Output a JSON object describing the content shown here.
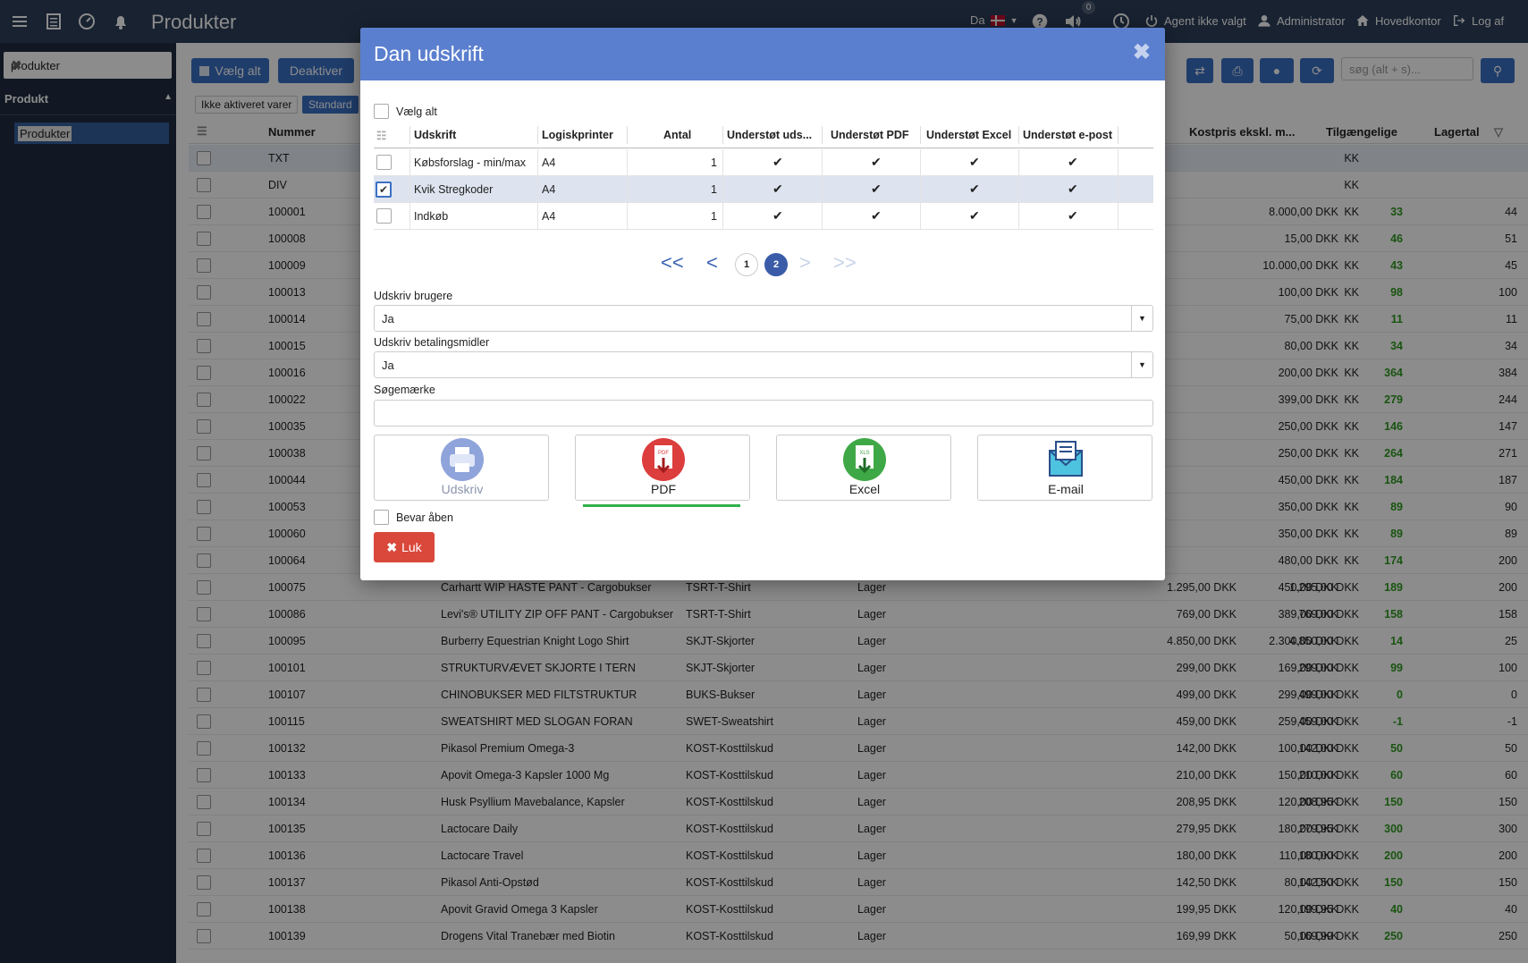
{
  "topbar": {
    "title": "Produkter",
    "lang": "Da",
    "notif_count": "0",
    "agent": "Agent ikke valgt",
    "user": "Administrator",
    "office": "Hovedkontor",
    "logout": "Log af"
  },
  "sidebar": {
    "search_value": "produkter",
    "section": "Produkt",
    "item": "Produkter"
  },
  "toolbar": {
    "select_all": "Vælg alt",
    "deactivate": "Deaktiver",
    "filter_inactive": "Ikke aktiveret varer",
    "filter_standard": "Standard",
    "search_placeholder": "søg (alt + s)..."
  },
  "table": {
    "headers": [
      "Nummer",
      "Kostpris ekskl. m...",
      "Tilgængelige",
      "Lagertal"
    ],
    "rows": [
      {
        "num": "TXT",
        "name": "",
        "group": "",
        "type": "",
        "p1": "",
        "p2": "KK",
        "cost": "",
        "avail": "",
        "stock": ""
      },
      {
        "num": "DIV",
        "name": "",
        "group": "",
        "type": "",
        "p1": "",
        "p2": "KK",
        "cost": "",
        "avail": "",
        "stock": ""
      },
      {
        "num": "100001",
        "name": "",
        "group": "",
        "type": "",
        "p1": "",
        "p2": "KK",
        "cost": "8.000,00 DKK",
        "avail": "33",
        "stock": "44"
      },
      {
        "num": "100008",
        "name": "",
        "group": "",
        "type": "",
        "p1": "",
        "p2": "KK",
        "cost": "15,00 DKK",
        "avail": "46",
        "stock": "51"
      },
      {
        "num": "100009",
        "name": "",
        "group": "",
        "type": "",
        "p1": "",
        "p2": "KK",
        "cost": "10.000,00 DKK",
        "avail": "43",
        "stock": "45"
      },
      {
        "num": "100013",
        "name": "",
        "group": "",
        "type": "",
        "p1": "",
        "p2": "KK",
        "cost": "100,00 DKK",
        "avail": "98",
        "stock": "100"
      },
      {
        "num": "100014",
        "name": "",
        "group": "",
        "type": "",
        "p1": "",
        "p2": "KK",
        "cost": "75,00 DKK",
        "avail": "11",
        "stock": "11"
      },
      {
        "num": "100015",
        "name": "",
        "group": "",
        "type": "",
        "p1": "",
        "p2": "KK",
        "cost": "80,00 DKK",
        "avail": "34",
        "stock": "34"
      },
      {
        "num": "100016",
        "name": "",
        "group": "",
        "type": "",
        "p1": "",
        "p2": "KK",
        "cost": "200,00 DKK",
        "avail": "364",
        "stock": "384"
      },
      {
        "num": "100022",
        "name": "",
        "group": "",
        "type": "",
        "p1": "",
        "p2": "KK",
        "cost": "399,00 DKK",
        "avail": "279",
        "stock": "244"
      },
      {
        "num": "100035",
        "name": "",
        "group": "",
        "type": "",
        "p1": "",
        "p2": "KK",
        "cost": "250,00 DKK",
        "avail": "146",
        "stock": "147"
      },
      {
        "num": "100038",
        "name": "",
        "group": "",
        "type": "",
        "p1": "",
        "p2": "KK",
        "cost": "250,00 DKK",
        "avail": "264",
        "stock": "271"
      },
      {
        "num": "100044",
        "name": "",
        "group": "",
        "type": "",
        "p1": "",
        "p2": "KK",
        "cost": "450,00 DKK",
        "avail": "184",
        "stock": "187"
      },
      {
        "num": "100053",
        "name": "",
        "group": "",
        "type": "",
        "p1": "",
        "p2": "KK",
        "cost": "350,00 DKK",
        "avail": "89",
        "stock": "90"
      },
      {
        "num": "100060",
        "name": "",
        "group": "",
        "type": "",
        "p1": "",
        "p2": "KK",
        "cost": "350,00 DKK",
        "avail": "89",
        "stock": "89"
      },
      {
        "num": "100064",
        "name": "",
        "group": "",
        "type": "",
        "p1": "",
        "p2": "KK",
        "cost": "480,00 DKK",
        "avail": "174",
        "stock": "200"
      },
      {
        "num": "100075",
        "name": "Carhartt WIP HASTE PANT - Cargobukser",
        "group": "TSRT-T-Shirt",
        "type": "Lager",
        "p1": "1.295,00 DKK",
        "p2": "1.295,00 DKK",
        "cost": "450,00 DKK",
        "avail": "189",
        "stock": "200"
      },
      {
        "num": "100086",
        "name": "Levi's® UTILITY ZIP OFF PANT - Cargobukser",
        "group": "TSRT-T-Shirt",
        "type": "Lager",
        "p1": "769,00 DKK",
        "p2": "769,00 DKK",
        "cost": "389,00 DKK",
        "avail": "158",
        "stock": "158"
      },
      {
        "num": "100095",
        "name": "Burberry Equestrian Knight Logo Shirt",
        "group": "SKJT-Skjorter",
        "type": "Lager",
        "p1": "4.850,00 DKK",
        "p2": "4.850,00 DKK",
        "cost": "2.300,00 DKK",
        "avail": "14",
        "stock": "25"
      },
      {
        "num": "100101",
        "name": "STRUKTURVÆVET SKJORTE I TERN",
        "group": "SKJT-Skjorter",
        "type": "Lager",
        "p1": "299,00 DKK",
        "p2": "299,00 DKK",
        "cost": "169,00 DKK",
        "avail": "99",
        "stock": "100"
      },
      {
        "num": "100107",
        "name": "CHINOBUKSER MED FILTSTRUKTUR",
        "group": "BUKS-Bukser",
        "type": "Lager",
        "p1": "499,00 DKK",
        "p2": "499,00 DKK",
        "cost": "299,00 DKK",
        "avail": "0",
        "stock": "0"
      },
      {
        "num": "100115",
        "name": "SWEATSHIRT MED SLOGAN FORAN",
        "group": "SWET-Sweatshirt",
        "type": "Lager",
        "p1": "459,00 DKK",
        "p2": "459,00 DKK",
        "cost": "259,00 DKK",
        "avail": "-1",
        "stock": "-1"
      },
      {
        "num": "100132",
        "name": "Pikasol Premium Omega-3",
        "group": "KOST-Kosttilskud",
        "type": "Lager",
        "p1": "142,00 DKK",
        "p2": "142,00 DKK",
        "cost": "100,00 DKK",
        "avail": "50",
        "stock": "50"
      },
      {
        "num": "100133",
        "name": "Apovit Omega-3 Kapsler 1000 Mg",
        "group": "KOST-Kosttilskud",
        "type": "Lager",
        "p1": "210,00 DKK",
        "p2": "210,00 DKK",
        "cost": "150,00 DKK",
        "avail": "60",
        "stock": "60"
      },
      {
        "num": "100134",
        "name": "Husk Psyllium Mavebalance, Kapsler",
        "group": "KOST-Kosttilskud",
        "type": "Lager",
        "p1": "208,95 DKK",
        "p2": "208,95 DKK",
        "cost": "120,00 DKK",
        "avail": "150",
        "stock": "150"
      },
      {
        "num": "100135",
        "name": "Lactocare Daily",
        "group": "KOST-Kosttilskud",
        "type": "Lager",
        "p1": "279,95 DKK",
        "p2": "279,95 DKK",
        "cost": "180,00 DKK",
        "avail": "300",
        "stock": "300"
      },
      {
        "num": "100136",
        "name": "Lactocare Travel",
        "group": "KOST-Kosttilskud",
        "type": "Lager",
        "p1": "180,00 DKK",
        "p2": "180,00 DKK",
        "cost": "110,00 DKK",
        "avail": "200",
        "stock": "200"
      },
      {
        "num": "100137",
        "name": "Pikasol Anti-Opstød",
        "group": "KOST-Kosttilskud",
        "type": "Lager",
        "p1": "142,50 DKK",
        "p2": "142,50 DKK",
        "cost": "80,00 DKK",
        "avail": "150",
        "stock": "150"
      },
      {
        "num": "100138",
        "name": "Apovit Gravid Omega 3 Kapsler",
        "group": "KOST-Kosttilskud",
        "type": "Lager",
        "p1": "199,95 DKK",
        "p2": "199,95 DKK",
        "cost": "120,00 DKK",
        "avail": "40",
        "stock": "40"
      },
      {
        "num": "100139",
        "name": "Drogens Vital Tranebær med Biotin",
        "group": "KOST-Kosttilskud",
        "type": "Lager",
        "p1": "169,99 DKK",
        "p2": "169,99 DKK",
        "cost": "50,00 DKK",
        "avail": "250",
        "stock": "250"
      }
    ]
  },
  "modal": {
    "title": "Dan udskrift",
    "select_all": "Vælg alt",
    "headers": [
      "Udskrift",
      "Logiskprinter",
      "Antal",
      "Understøt uds...",
      "Understøt PDF",
      "Understøt Excel",
      "Understøt e-post"
    ],
    "rows": [
      {
        "name": "Købsforslag - min/max",
        "printer": "A4",
        "count": "1"
      },
      {
        "name": "Kvik Stregkoder",
        "printer": "A4",
        "count": "1"
      },
      {
        "name": "Indkøb",
        "printer": "A4",
        "count": "1"
      }
    ],
    "pager": {
      "first": "<<",
      "prev": "<",
      "p1": "1",
      "p2": "2",
      "next": ">",
      "last": ">>"
    },
    "users_label": "Udskriv brugere",
    "users_value": "Ja",
    "payment_label": "Udskriv betalingsmidler",
    "payment_value": "Ja",
    "tag_label": "Søgemærke",
    "actions": {
      "print": "Udskriv",
      "pdf": "PDF",
      "excel": "Excel",
      "email": "E-mail"
    },
    "keep_open": "Bevar åben",
    "close": "Luk"
  },
  "colors": {
    "topbar": "#2d3e59",
    "modal_header": "#5b7fcf",
    "accent": "#3a6fc4",
    "green": "#2f9a1f",
    "danger": "#d9483b"
  }
}
